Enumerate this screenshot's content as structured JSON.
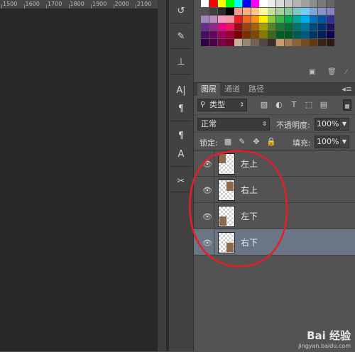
{
  "ruler": {
    "labels": [
      "1500",
      "1600",
      "1700",
      "1800",
      "1900",
      "2000",
      "2100"
    ]
  },
  "tools": [
    {
      "name": "history-brush-icon",
      "glyph": "↺"
    },
    {
      "name": "brush-preset-icon",
      "glyph": "✎"
    },
    {
      "name": "tool-preset-icon",
      "glyph": "⊥"
    },
    {
      "name": "character-panel-icon",
      "glyph": "A|"
    },
    {
      "name": "paragraph-panel-icon",
      "glyph": "¶"
    },
    {
      "name": "paragraph-style-icon",
      "glyph": "¶"
    },
    {
      "name": "character-style-icon",
      "glyph": "A"
    },
    {
      "name": "tool-options-icon",
      "glyph": "✂"
    }
  ],
  "swatch_rows": [
    [
      "#ffffff",
      "#ff0000",
      "#ffff00",
      "#00ff00",
      "#00ffff",
      "#0000ff",
      "#ff00ff",
      "#ffffff",
      "#ececec",
      "#d9d9d9",
      "#c6c6c6",
      "#b3b3b3",
      "#a0a0a0",
      "#8c8c8c",
      "#797979",
      "#666666"
    ],
    [
      "#525252",
      "#3f3f3f",
      "#2c2c2c",
      "#000000",
      "#f6998f",
      "#f9ad81",
      "#fdc689",
      "#fff799",
      "#c4df9b",
      "#a3d39c",
      "#82ca9c",
      "#7accc8",
      "#6dcff6",
      "#7da7d8",
      "#8493ca",
      "#8882be"
    ],
    [
      "#a187be",
      "#bc8cbf",
      "#f49ac2",
      "#f6989d",
      "#ed1c24",
      "#f26522",
      "#f7941d",
      "#fff200",
      "#8dc63f",
      "#39b54a",
      "#00a651",
      "#00a99d",
      "#00aeef",
      "#0072bc",
      "#0054a6",
      "#2e3192"
    ],
    [
      "#662d91",
      "#92278f",
      "#ec008c",
      "#ed145b",
      "#9e0b0f",
      "#a0410d",
      "#a3620a",
      "#aba000",
      "#598527",
      "#1a7b30",
      "#007236",
      "#00746b",
      "#0076a3",
      "#004a80",
      "#003471",
      "#1b1464"
    ],
    [
      "#440e62",
      "#630460",
      "#9e005d",
      "#9e0039",
      "#790000",
      "#7b2e00",
      "#7d4900",
      "#827b00",
      "#406618",
      "#005e20",
      "#005826",
      "#005952",
      "#005b7f",
      "#003663",
      "#002157",
      "#0d004c"
    ],
    [
      "#32004b",
      "#4b0049",
      "#7b0046",
      "#7a0026",
      "#c7b299",
      "#998675",
      "#736357",
      "#534741",
      "#37302a",
      "#c69c6d",
      "#a67c52",
      "#8c6239",
      "#754c24",
      "#603913",
      "#3c2415",
      "#2a1b10"
    ]
  ],
  "layers_panel": {
    "tabs": [
      "图层",
      "通道",
      "路径"
    ],
    "filter_label": "类型",
    "blend_mode": "正常",
    "opacity_label": "不透明度:",
    "opacity_value": "100%",
    "lock_label": "锁定:",
    "fill_label": "填充:",
    "fill_value": "100%",
    "layers": [
      {
        "name": "左上",
        "selected": false,
        "corner": "tl"
      },
      {
        "name": "右上",
        "selected": false,
        "corner": "tr"
      },
      {
        "name": "左下",
        "selected": false,
        "corner": "bl"
      },
      {
        "name": "右下",
        "selected": true,
        "corner": "br"
      }
    ]
  },
  "watermark": {
    "brand": "Bai 经验",
    "url": "jingyan.baidu.com"
  },
  "colors": {
    "selection": "#6a7686",
    "annotation": "#e0202a"
  }
}
